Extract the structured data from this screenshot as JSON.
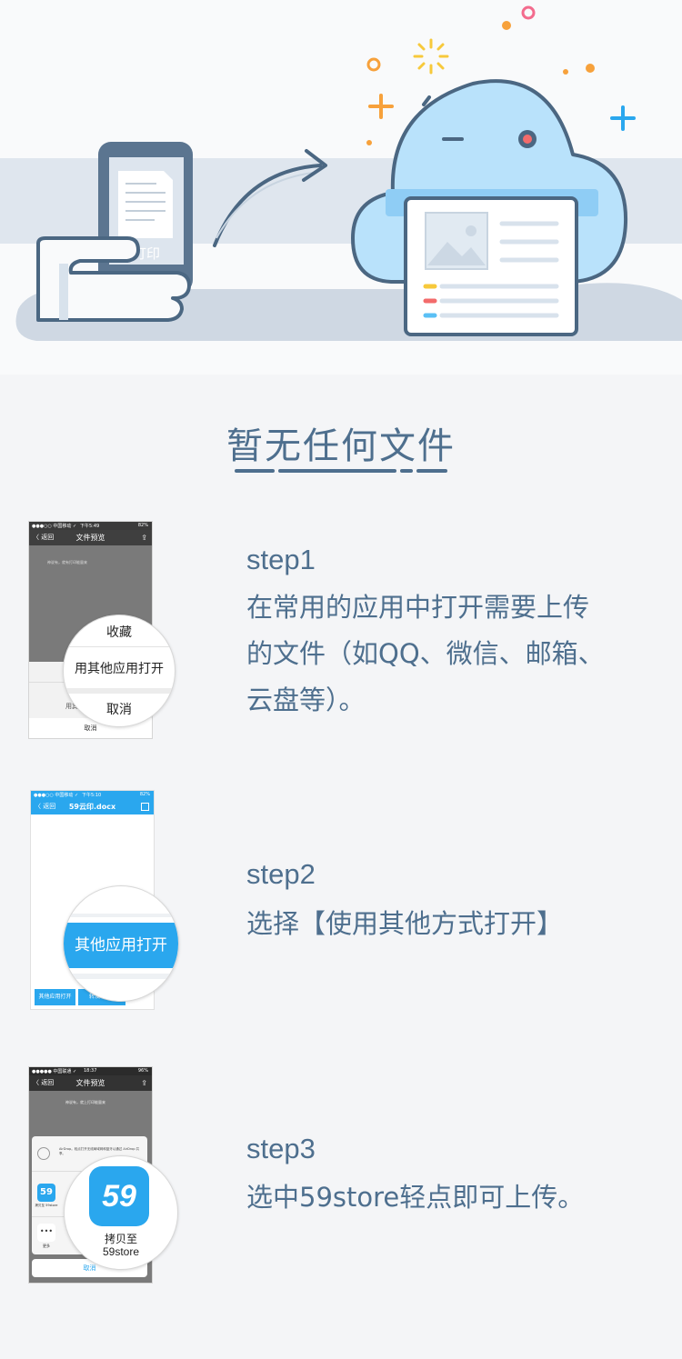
{
  "hero": {
    "phone_screen_label": "打印"
  },
  "empty_state": {
    "title": "暂无任何文件"
  },
  "steps": [
    {
      "label": "step1",
      "description": "在常用的应用中打开需要上传的文件（如QQ、微信、邮箱、云盘等）。",
      "lines": [
        "在常用的应用中打开需要上传",
        "的文件（如QQ、微信、邮箱、",
        "云盘等）。"
      ],
      "screenshot": {
        "status_left": "●●●○○ 中国移动 ✓",
        "status_center": "下午5:49",
        "status_right": "82%",
        "back": "〈 返回",
        "nav_title": "文件预览",
        "preview_text": "神说有，就有打印能量来",
        "menu_items": [
          "收藏",
          "用其他应用打开",
          "取消"
        ],
        "sheet_partial": "用其",
        "sheet_cancel": "取消"
      }
    },
    {
      "label": "step2",
      "description": "选择【使用其他方式打开】",
      "lines": [
        "选择【使用其他方式打开】"
      ],
      "screenshot": {
        "status_left": "●●●○○ 中国移动 ✓",
        "status_center": "下午5:10",
        "status_right": "82%",
        "back": "〈 返回",
        "nav_title": "59云印.docx",
        "magnified_button": "其他应用打开",
        "bottom_button": "其他应用打开",
        "bottom_partial": "转发"
      }
    },
    {
      "label": "step3",
      "description": "选中59store轻点即可上传。",
      "lines": [
        "选中59store轻点即可上传。"
      ],
      "screenshot": {
        "status_left": "●●●●● 中国联通 ✓",
        "status_center": "18:37",
        "status_right": "96%",
        "back": "〈 返回",
        "nav_title": "文件预览",
        "preview_text": "神说有，就上打印能量来",
        "airdrop_title": "AirDrop。轻点打开无线局域网和蓝牙以通过 AirDrop 共享。",
        "app_icon_text": "59",
        "app_name_small": "拷贝至 59store",
        "more_label": "更多",
        "cancel": "取消",
        "magnified_app_line1": "拷贝至",
        "magnified_app_line2": "59store"
      }
    }
  ],
  "colors": {
    "text_primary": "#4e6f8e",
    "background": "#f4f5f7",
    "cloud": "#b9e2fb",
    "accent_blue": "#2aa7ee",
    "accent_orange": "#f7a13b",
    "accent_pink": "#f36b8d",
    "outline": "#4b6782"
  }
}
